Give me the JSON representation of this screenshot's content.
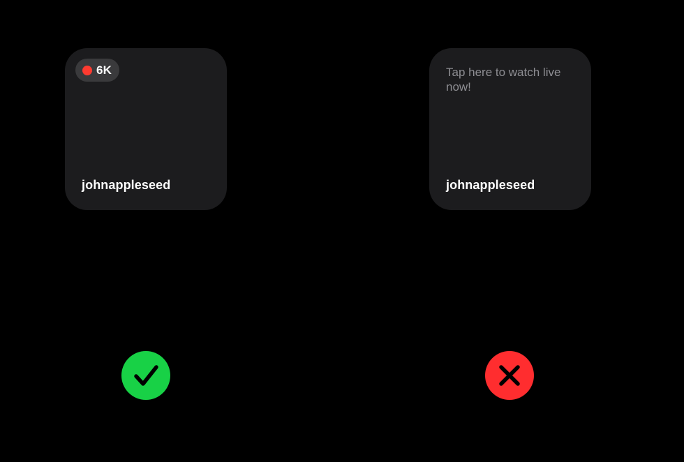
{
  "good_example": {
    "live_badge": {
      "count": "6K",
      "dot_color": "#ff3b30"
    },
    "username": "johnappleseed",
    "status_icon": "checkmark-icon",
    "status_color": "#18d146"
  },
  "bad_example": {
    "prompt": "Tap here to watch live now!",
    "username": "johnappleseed",
    "status_icon": "xmark-icon",
    "status_color": "#ff2d2f"
  },
  "colors": {
    "background": "#000000",
    "tile": "#1c1c1e",
    "badge": "#3a3a3c",
    "prompt_text": "#8e8e93",
    "username_text": "#ffffff"
  }
}
